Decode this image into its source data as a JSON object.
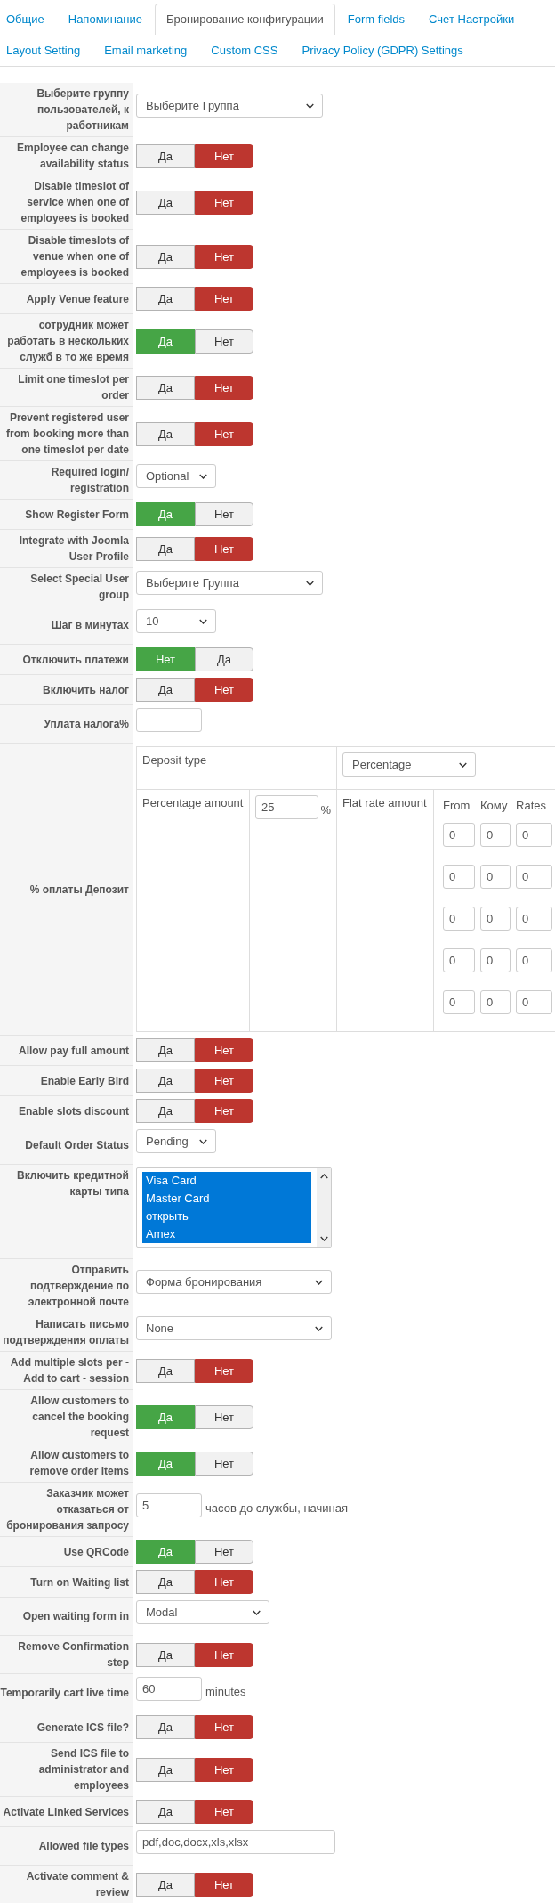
{
  "tabs": [
    {
      "label": "Общие",
      "selected": false
    },
    {
      "label": "Напоминание",
      "selected": false
    },
    {
      "label": "Бронирование конфигурации",
      "selected": true
    },
    {
      "label": "Form fields",
      "selected": false
    },
    {
      "label": "Счет Настройки",
      "selected": false
    },
    {
      "label": "Layout Setting",
      "selected": false
    },
    {
      "label": "Email marketing",
      "selected": false
    },
    {
      "label": "Custom CSS",
      "selected": false
    },
    {
      "label": "Privacy Policy (GDPR) Settings",
      "selected": false
    }
  ],
  "settings": [
    {
      "kind": "select",
      "label": "Выберите группу пользователей, к работникам",
      "value": "Выберите Группа"
    },
    {
      "kind": "toggle",
      "label": "Employee can change availability status",
      "options": [
        {
          "label": "Да",
          "selected": false
        },
        {
          "label": "Нет",
          "selected": true
        }
      ]
    },
    {
      "kind": "toggle",
      "label": "Disable timeslot of service when one of employees is booked",
      "options": [
        {
          "label": "Да",
          "selected": false
        },
        {
          "label": "Нет",
          "selected": true
        }
      ]
    },
    {
      "kind": "toggle",
      "label": "Disable timeslots of venue when one of employees is booked",
      "options": [
        {
          "label": "Да",
          "selected": false
        },
        {
          "label": "Нет",
          "selected": true
        }
      ]
    },
    {
      "kind": "toggle",
      "label": "Apply Venue feature",
      "options": [
        {
          "label": "Да",
          "selected": false
        },
        {
          "label": "Нет",
          "selected": true
        }
      ]
    },
    {
      "kind": "toggle",
      "label": "сотрудник может работать в нескольких служб в то же время",
      "options": [
        {
          "label": "Да",
          "selected": true
        },
        {
          "label": "Нет",
          "selected": false
        }
      ]
    },
    {
      "kind": "toggle",
      "label": "Limit one timeslot per order",
      "options": [
        {
          "label": "Да",
          "selected": false
        },
        {
          "label": "Нет",
          "selected": true
        }
      ]
    },
    {
      "kind": "toggle",
      "label": "Prevent registered user from booking more than one timeslot per date",
      "options": [
        {
          "label": "Да",
          "selected": false
        },
        {
          "label": "Нет",
          "selected": true
        }
      ]
    },
    {
      "kind": "select",
      "label": "Required login/ registration",
      "value": "Optional"
    },
    {
      "kind": "toggle",
      "label": "Show Register Form",
      "options": [
        {
          "label": "Да",
          "selected": true
        },
        {
          "label": "Нет",
          "selected": false
        }
      ]
    },
    {
      "kind": "toggle",
      "label": "Integrate with Joomla User Profile",
      "options": [
        {
          "label": "Да",
          "selected": false
        },
        {
          "label": "Нет",
          "selected": true
        }
      ]
    },
    {
      "kind": "select",
      "label": "Select Special User group",
      "value": "Выберите Группа"
    },
    {
      "kind": "select",
      "label": "Шаг в минутах",
      "value": "10"
    },
    {
      "kind": "toggle",
      "label": "Отключить платежи",
      "options": [
        {
          "label": "Нет",
          "selected": true
        },
        {
          "label": "Да",
          "selected": false
        }
      ]
    },
    {
      "kind": "toggle",
      "label": "Включить налог",
      "options": [
        {
          "label": "Да",
          "selected": false
        },
        {
          "label": "Нет",
          "selected": true
        }
      ]
    },
    {
      "kind": "text",
      "label": "Уплата налога%"
    },
    {
      "kind": "deposit",
      "label": "% оплаты Депозит",
      "deposit_type": {
        "label": "Deposit type",
        "value": "Percentage"
      },
      "percentage_amount": {
        "label": "Percentage amount",
        "value": "25",
        "unit": "%"
      },
      "flat_rate_amount": {
        "label": "Flat rate amount",
        "columns": [
          "From",
          "Кому",
          "Rates"
        ],
        "rows": [
          [
            "0",
            "0",
            "0"
          ],
          [
            "0",
            "0",
            "0"
          ],
          [
            "0",
            "0",
            "0"
          ],
          [
            "0",
            "0",
            "0"
          ],
          [
            "0",
            "0",
            "0"
          ]
        ]
      }
    },
    {
      "kind": "toggle",
      "label": "Allow pay full amount",
      "options": [
        {
          "label": "Да",
          "selected": false
        },
        {
          "label": "Нет",
          "selected": true
        }
      ]
    },
    {
      "kind": "toggle",
      "label": "Enable Early Bird",
      "options": [
        {
          "label": "Да",
          "selected": false
        },
        {
          "label": "Нет",
          "selected": true
        }
      ]
    },
    {
      "kind": "toggle",
      "label": "Enable slots discount",
      "options": [
        {
          "label": "Да",
          "selected": false
        },
        {
          "label": "Нет",
          "selected": true
        }
      ]
    },
    {
      "kind": "select",
      "label": "Default Order Status",
      "value": "Pending"
    },
    {
      "kind": "listbox",
      "label": "Включить кредитной карты типа",
      "options": [
        {
          "label": "Visa Card",
          "selected": true
        },
        {
          "label": "Master Card",
          "selected": true
        },
        {
          "label": "открыть",
          "selected": true
        },
        {
          "label": "Amex",
          "selected": true
        }
      ]
    },
    {
      "kind": "select",
      "label": "Отправить подтверждение по электронной почте",
      "value": "Форма бронирования"
    },
    {
      "kind": "select",
      "label": "Написать письмо подтверждения оплаты",
      "value": "None"
    },
    {
      "kind": "toggle",
      "label": "Add multiple slots per - Add to cart - session",
      "options": [
        {
          "label": "Да",
          "selected": false
        },
        {
          "label": "Нет",
          "selected": true
        }
      ]
    },
    {
      "kind": "toggle",
      "label": "Allow customers to cancel the booking request",
      "options": [
        {
          "label": "Да",
          "selected": true
        },
        {
          "label": "Нет",
          "selected": false
        }
      ]
    },
    {
      "kind": "toggle",
      "label": "Allow customers to remove order items",
      "options": [
        {
          "label": "Да",
          "selected": true
        },
        {
          "label": "Нет",
          "selected": false
        }
      ]
    },
    {
      "kind": "text",
      "label": "Заказчик может отказаться от бронирования запросу",
      "value": "5",
      "suffix": "часов до службы, начиная"
    },
    {
      "kind": "toggle",
      "label": "Use QRCode",
      "options": [
        {
          "label": "Да",
          "selected": true
        },
        {
          "label": "Нет",
          "selected": false
        }
      ]
    },
    {
      "kind": "toggle",
      "label": "Turn on Waiting list",
      "options": [
        {
          "label": "Да",
          "selected": false
        },
        {
          "label": "Нет",
          "selected": true
        }
      ]
    },
    {
      "kind": "select",
      "label": "Open waiting form in",
      "value": "Modal"
    },
    {
      "kind": "toggle",
      "label": "Remove Confirmation step",
      "options": [
        {
          "label": "Да",
          "selected": false
        },
        {
          "label": "Нет",
          "selected": true
        }
      ]
    },
    {
      "kind": "text",
      "label": "Temporarily cart live time",
      "value": "60",
      "suffix": "minutes"
    },
    {
      "kind": "toggle",
      "label": "Generate ICS file?",
      "options": [
        {
          "label": "Да",
          "selected": false
        },
        {
          "label": "Нет",
          "selected": true
        }
      ]
    },
    {
      "kind": "toggle",
      "label": "Send ICS file to administrator and employees",
      "options": [
        {
          "label": "Да",
          "selected": false
        },
        {
          "label": "Нет",
          "selected": true
        }
      ]
    },
    {
      "kind": "toggle",
      "label": "Activate Linked Services",
      "options": [
        {
          "label": "Да",
          "selected": false
        },
        {
          "label": "Нет",
          "selected": true
        }
      ]
    },
    {
      "kind": "text",
      "label": "Allowed file types",
      "value": "pdf,doc,docx,xls,xlsx"
    },
    {
      "kind": "toggle",
      "label": "Activate comment & review",
      "options": [
        {
          "label": "Да",
          "selected": false
        },
        {
          "label": "Нет",
          "selected": true
        }
      ]
    }
  ]
}
